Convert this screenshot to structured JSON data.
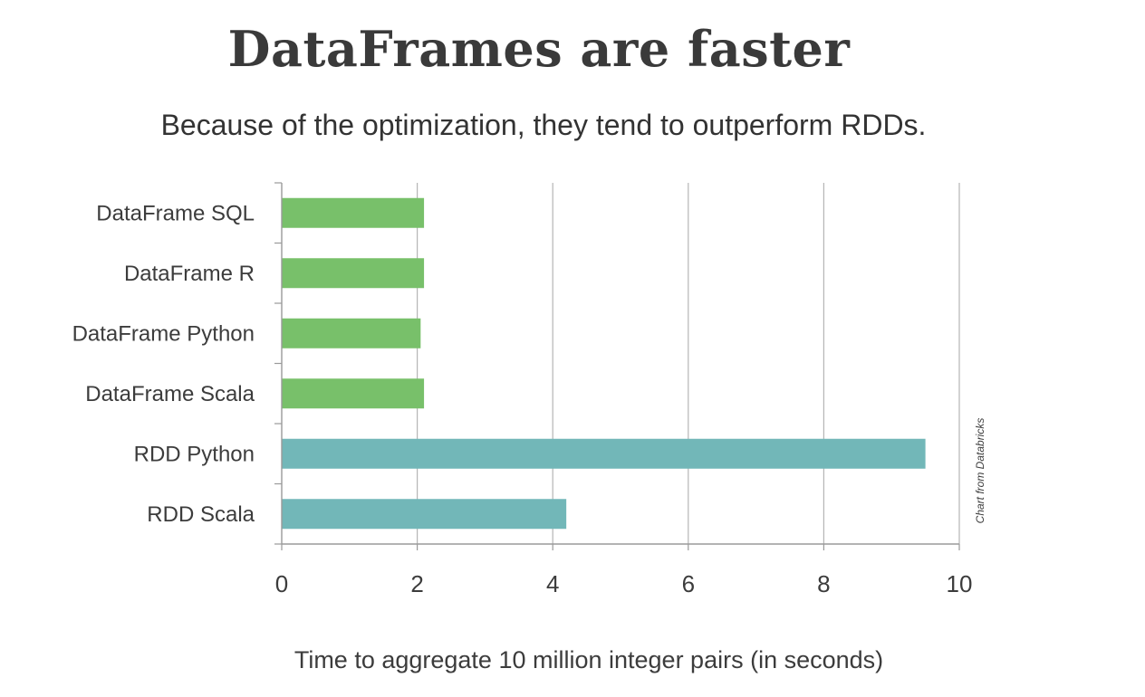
{
  "slide": {
    "title": "DataFrames are faster",
    "subtitle": "Because of the optimization, they tend to outperform RDDs.",
    "credit": "Chart from Databricks"
  },
  "chart_data": {
    "type": "bar",
    "orientation": "horizontal",
    "categories": [
      "DataFrame SQL",
      "DataFrame R",
      "DataFrame Python",
      "DataFrame Scala",
      "RDD Python",
      "RDD Scala"
    ],
    "values": [
      2.1,
      2.1,
      2.05,
      2.1,
      9.5,
      4.2
    ],
    "colors": [
      "#78c06a",
      "#78c06a",
      "#78c06a",
      "#78c06a",
      "#72b7b8",
      "#72b7b8"
    ],
    "xlabel": "Time to aggregate 10 million integer pairs (in seconds)",
    "ylabel": "",
    "xlim": [
      0,
      10
    ],
    "xticks": [
      0,
      2,
      4,
      6,
      8,
      10
    ],
    "grid": true,
    "legend": "none"
  }
}
